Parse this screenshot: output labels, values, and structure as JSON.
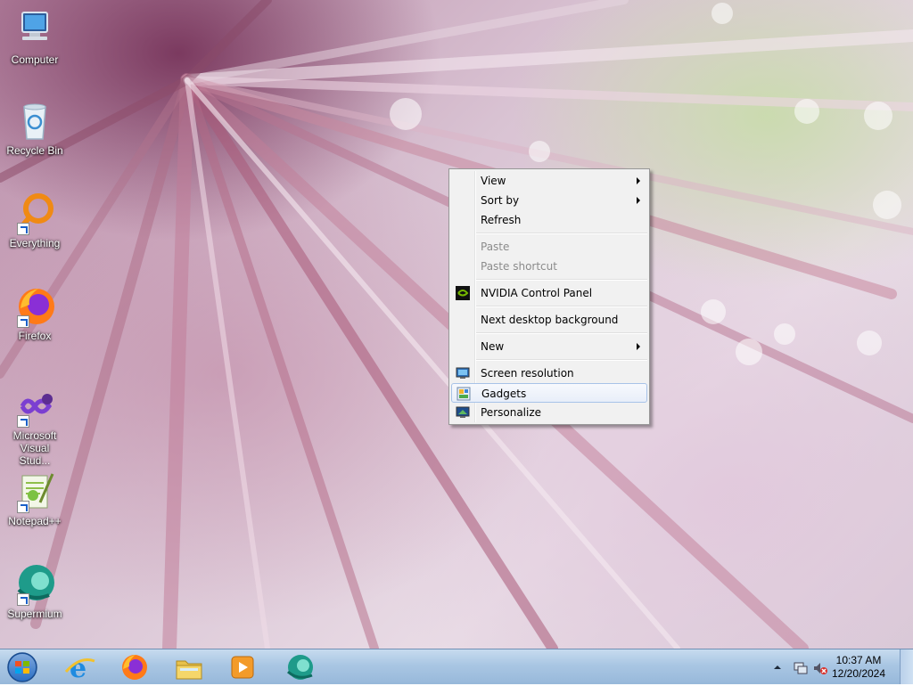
{
  "desktop_icons": [
    {
      "label": "Computer"
    },
    {
      "label": "Recycle Bin"
    },
    {
      "label": "Everything"
    },
    {
      "label": "Firefox"
    },
    {
      "label": "Microsoft Visual Stud..."
    },
    {
      "label": "Notepad++"
    },
    {
      "label": "Supermium"
    }
  ],
  "context_menu": {
    "items": [
      {
        "label": "View",
        "submenu": true
      },
      {
        "label": "Sort by",
        "submenu": true
      },
      {
        "label": "Refresh"
      },
      {
        "label": "Paste",
        "disabled": true
      },
      {
        "label": "Paste shortcut",
        "disabled": true
      },
      {
        "label": "NVIDIA Control Panel",
        "icon": "nvidia-icon"
      },
      {
        "label": "Next desktop background"
      },
      {
        "label": "New",
        "submenu": true
      },
      {
        "label": "Screen resolution",
        "icon": "monitor-icon"
      },
      {
        "label": "Gadgets",
        "icon": "gadgets-icon",
        "highlighted": true
      },
      {
        "label": "Personalize",
        "icon": "personalize-icon"
      }
    ]
  },
  "taskbar": {
    "pinned": [
      "internet-explorer-icon",
      "firefox-icon",
      "file-explorer-icon",
      "media-player-icon",
      "supermium-icon"
    ],
    "tray_icons": [
      "show-hidden-icons-chevron",
      "network-icon",
      "volume-muted-icon"
    ],
    "clock": {
      "time": "10:37 AM",
      "date": "12/20/2024"
    }
  }
}
